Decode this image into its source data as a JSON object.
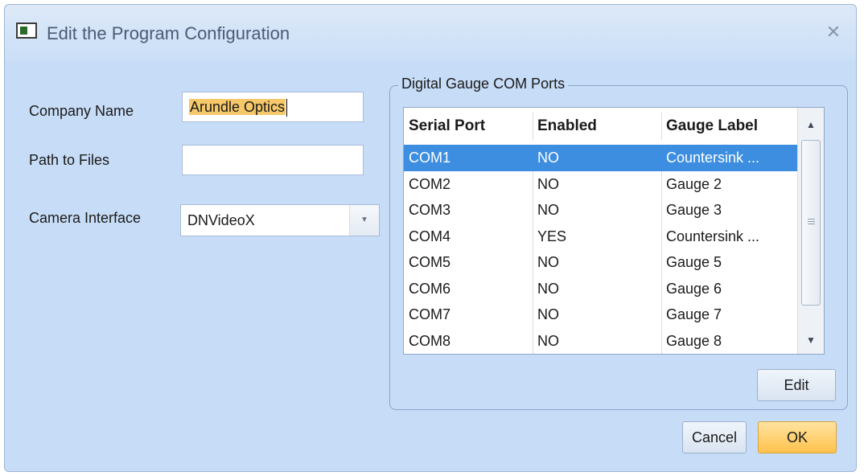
{
  "window": {
    "title": "Edit the Program Configuration",
    "close_glyph": "✕"
  },
  "form": {
    "company_name_label": "Company Name",
    "company_name_value": "Arundle Optics",
    "path_label": "Path to Files",
    "path_value": "",
    "camera_label": "Camera Interface",
    "camera_value": "DNVideoX"
  },
  "gauge_group": {
    "title": "Digital Gauge COM Ports",
    "columns": [
      "Serial Port",
      "Enabled",
      "Gauge Label"
    ],
    "rows": [
      {
        "port": "COM1",
        "enabled": "NO",
        "label": "Countersink ..."
      },
      {
        "port": "COM2",
        "enabled": "NO",
        "label": "Gauge 2"
      },
      {
        "port": "COM3",
        "enabled": "NO",
        "label": "Gauge 3"
      },
      {
        "port": "COM4",
        "enabled": "YES",
        "label": "Countersink ..."
      },
      {
        "port": "COM5",
        "enabled": "NO",
        "label": "Gauge 5"
      },
      {
        "port": "COM6",
        "enabled": "NO",
        "label": "Gauge 6"
      },
      {
        "port": "COM7",
        "enabled": "NO",
        "label": "Gauge 7"
      },
      {
        "port": "COM8",
        "enabled": "NO",
        "label": "Gauge 8"
      }
    ],
    "selected_row": 0,
    "edit_button": "Edit"
  },
  "footer": {
    "cancel_button": "Cancel",
    "ok_button": "OK"
  },
  "icons": {
    "scroll_up": "▲",
    "scroll_down": "▼",
    "dropdown": "▼"
  },
  "colors": {
    "dialog_background": "#c7dcf6",
    "selection": "#3d8ee0",
    "text_highlight": "#f6c86a",
    "ok_button": "#ffc24c"
  }
}
